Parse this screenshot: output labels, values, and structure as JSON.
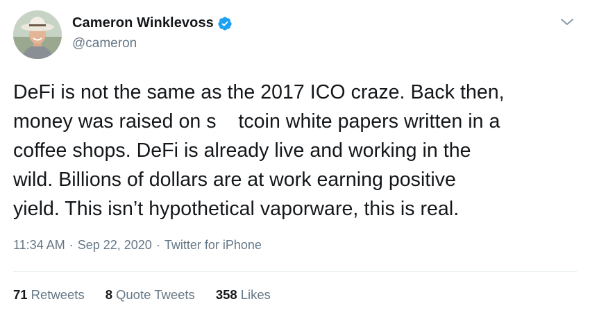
{
  "author": {
    "name": "Cameron Winklevoss",
    "handle": "@cameron",
    "verified_icon": "verified-badge-icon",
    "verified_color": "#1da1f2"
  },
  "tweet": {
    "lines": [
      "DeFi is not the same as the 2017 ICO craze. Back then,",
      "money was raised on s    tcoin white papers written in a",
      "coffee shops. DeFi is already live and working in the",
      "wild. Billions of dollars are at work earning positive",
      "yield. This isn’t hypothetical vaporware, this is real."
    ]
  },
  "meta": {
    "time": "11:34 AM",
    "separator": "·",
    "date": "Sep 22, 2020",
    "source": "Twitter for iPhone"
  },
  "stats": {
    "retweets_count": "71",
    "retweets_label": "Retweets",
    "quotes_count": "8",
    "quotes_label": "Quote Tweets",
    "likes_count": "358",
    "likes_label": "Likes"
  },
  "colors": {
    "text": "#14171a",
    "secondary": "#657786",
    "divider": "#e6ecf0"
  }
}
